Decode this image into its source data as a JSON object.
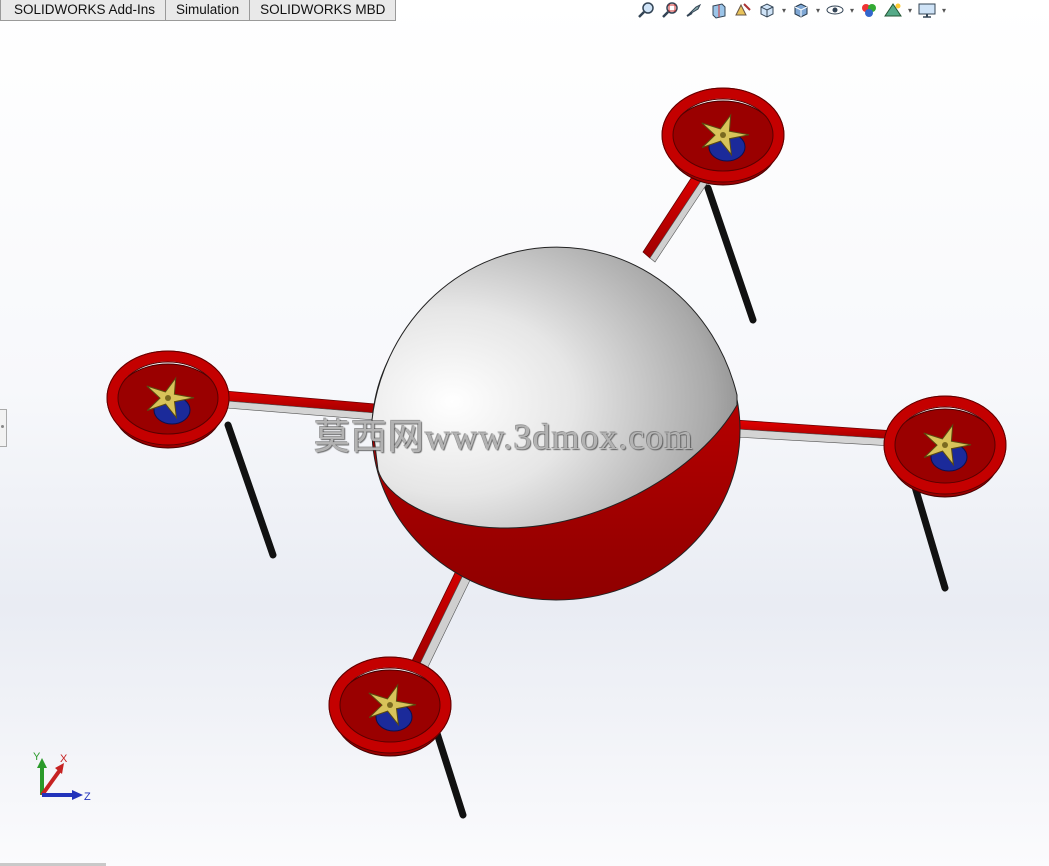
{
  "tabs": [
    {
      "label": "SOLIDWORKS Add-Ins"
    },
    {
      "label": "Simulation"
    },
    {
      "label": "SOLIDWORKS MBD"
    }
  ],
  "heads_up_toolbar": [
    {
      "icon": "zoom-to-fit-icon"
    },
    {
      "icon": "zoom-to-area-icon"
    },
    {
      "icon": "previous-view-icon"
    },
    {
      "icon": "section-view-icon"
    },
    {
      "icon": "dynamic-annotation-icon"
    },
    {
      "icon": "view-orientation-icon",
      "dropdown": true
    },
    {
      "icon": "display-style-icon",
      "dropdown": true
    },
    {
      "icon": "hide-show-items-icon",
      "dropdown": true
    },
    {
      "icon": "edit-appearance-icon"
    },
    {
      "icon": "apply-scene-icon",
      "dropdown": true
    },
    {
      "icon": "view-settings-icon",
      "dropdown": true
    }
  ],
  "watermark": {
    "text": "莫西网www.3dmox.com"
  },
  "triad": {
    "x_label": "X",
    "y_label": "Y",
    "z_label": "Z"
  },
  "colors": {
    "frame_red": "#c40000",
    "dome_silver": "#d9d9d9",
    "propeller_gold": "#d8c35a",
    "motor_blue": "#1b2a9a",
    "leg_black": "#111111"
  }
}
